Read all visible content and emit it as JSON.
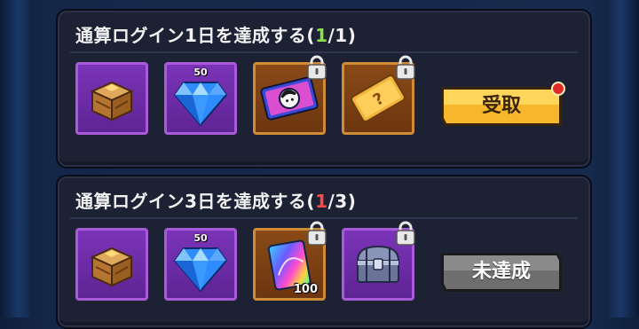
{
  "missions": [
    {
      "title": "通算ログイン1日を達成する",
      "progress_open": "(",
      "progress_current": "1",
      "progress_sep": "/",
      "progress_total": "1",
      "progress_close": ")",
      "progress_color": "#8be04a",
      "rewards": [
        {
          "icon": "treasure-crate-icon",
          "quantity": "",
          "locked": false,
          "frame": "purple"
        },
        {
          "icon": "blue-diamond-icon",
          "quantity": "50",
          "locked": false,
          "frame": "purple"
        },
        {
          "icon": "character-ticket-icon",
          "quantity": "",
          "locked": true,
          "frame": "orange"
        },
        {
          "icon": "mystery-ticket-icon",
          "quantity": "",
          "locked": true,
          "frame": "orange"
        }
      ],
      "button_label": "受取",
      "button_state": "claimable",
      "has_notification": true
    },
    {
      "title": "通算ログイン3日を達成する",
      "progress_open": "(",
      "progress_current": "1",
      "progress_sep": "/",
      "progress_total": "3",
      "progress_close": ")",
      "progress_color": "#ff4a4a",
      "rewards": [
        {
          "icon": "treasure-crate-icon",
          "quantity": "",
          "locked": false,
          "frame": "purple"
        },
        {
          "icon": "blue-diamond-icon",
          "quantity": "50",
          "locked": false,
          "frame": "purple"
        },
        {
          "icon": "rainbow-card-icon",
          "quantity": "100",
          "locked": true,
          "frame": "orange"
        },
        {
          "icon": "silver-chest-icon",
          "quantity": "",
          "locked": true,
          "frame": "purple"
        }
      ],
      "button_label": "未達成",
      "button_state": "locked",
      "has_notification": false
    }
  ]
}
